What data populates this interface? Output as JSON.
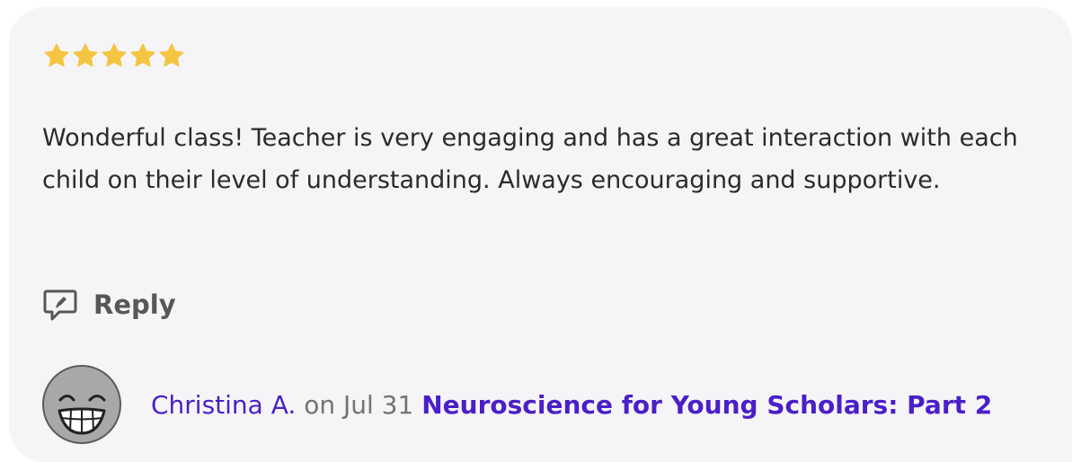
{
  "review": {
    "rating": 5,
    "max_rating": 5,
    "star_color": "#f5c542",
    "text": "Wonderful class! Teacher is very engaging and has a great interaction with each child on their level of understanding. Always encouraging and supportive."
  },
  "actions": {
    "reply_label": "Reply",
    "reply_icon": "reply-chat-icon"
  },
  "author": {
    "name": "Christina A.",
    "avatar_icon": "smiley-face-avatar",
    "date_text": "on Jul 31",
    "class_title": "Neuroscience for Young Scholars: Part 2"
  },
  "colors": {
    "link": "#4b1fc7",
    "card_background": "#f5f5f7",
    "text": "#2b2b2b",
    "muted": "#737373"
  }
}
